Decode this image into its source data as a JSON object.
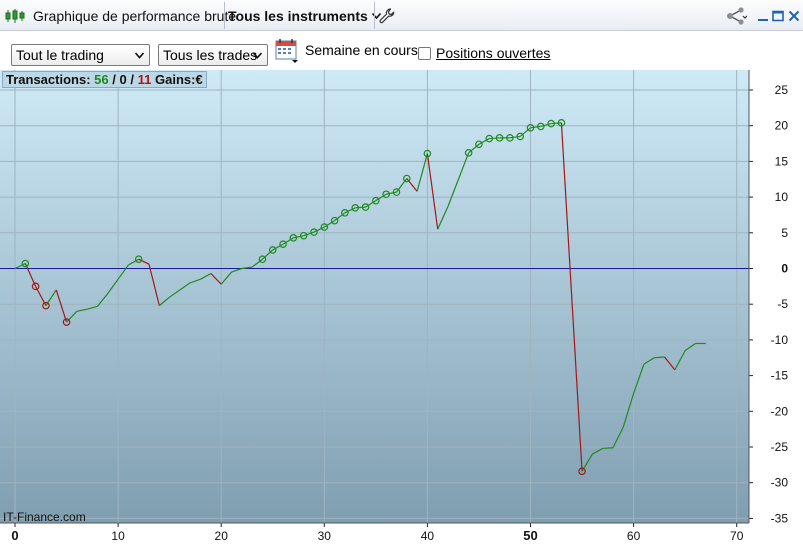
{
  "titlebar": {
    "title": "Graphique de performance brute",
    "instrument_scope": "Tous les instruments"
  },
  "icons": {
    "app": "candlestick-chart-icon",
    "wrench": "wrench-icon",
    "share": "share-icon",
    "minimize": "minimize-icon",
    "maximize": "maximize-icon",
    "close": "close-icon",
    "calendar": "calendar-icon"
  },
  "toolbar": {
    "trading_select": {
      "value": "Tout le trading"
    },
    "trades_select": {
      "value": "Tous les trades"
    },
    "week_label": "Semaine en cours",
    "positions_label": "Positions ouvertes",
    "positions_checked": false
  },
  "stats": {
    "transactions_label": "Transactions:",
    "wins": "56",
    "separator": "/",
    "neutral": "0",
    "losses": "11",
    "gains_label": "Gains:",
    "currency": "€"
  },
  "watermark": "IT-Finance.com",
  "colors": {
    "up": "#1f8a1f",
    "down": "#a01818",
    "zero_line": "#1a1a9a",
    "grid": "#9fb4c0"
  },
  "chart_data": {
    "type": "line",
    "xlim": [
      0,
      70
    ],
    "ylim": [
      -35,
      27
    ],
    "x_ticks": [
      "0",
      "10",
      "20",
      "30",
      "40",
      "50",
      "60",
      "70"
    ],
    "x_ticks_bold": [
      "0",
      "50"
    ],
    "y_ticks": [
      "25",
      "20",
      "15",
      "10",
      "5",
      "0",
      "-5",
      "-10",
      "-15",
      "-20",
      "-25",
      "-30",
      "-35"
    ],
    "grid": true,
    "zero_line": 0,
    "series": [
      {
        "values": [
          [
            0,
            0
          ],
          [
            1,
            0.7
          ],
          [
            2,
            -2.5
          ],
          [
            3,
            -5.2
          ],
          [
            4,
            -3
          ],
          [
            5,
            -7.5
          ],
          [
            6,
            -6
          ],
          [
            7,
            -5.7
          ],
          [
            8,
            -5.3
          ],
          [
            9,
            -3.5
          ],
          [
            10,
            -1.5
          ],
          [
            11,
            0.5
          ],
          [
            12,
            1.3
          ],
          [
            13,
            0.6
          ],
          [
            14,
            -5.2
          ],
          [
            15,
            -4
          ],
          [
            16,
            -3
          ],
          [
            17,
            -2
          ],
          [
            18,
            -1.5
          ],
          [
            19,
            -0.7
          ],
          [
            20,
            -2.2
          ],
          [
            21,
            -0.5
          ],
          [
            22,
            0
          ],
          [
            23,
            0.2
          ],
          [
            24,
            1.3
          ],
          [
            25,
            2.6
          ],
          [
            26,
            3.4
          ],
          [
            27,
            4.3
          ],
          [
            28,
            4.6
          ],
          [
            29,
            5.1
          ],
          [
            30,
            5.8
          ],
          [
            31,
            6.7
          ],
          [
            32,
            7.8
          ],
          [
            33,
            8.5
          ],
          [
            34,
            8.6
          ],
          [
            35,
            9.5
          ],
          [
            36,
            10.4
          ],
          [
            37,
            10.7
          ],
          [
            38,
            12.6
          ],
          [
            39,
            10.8
          ],
          [
            40,
            16.1
          ],
          [
            41,
            5.5
          ],
          [
            42,
            8.7
          ],
          [
            44,
            16.2
          ],
          [
            45,
            17.4
          ],
          [
            46,
            18.2
          ],
          [
            47,
            18.3
          ],
          [
            48,
            18.3
          ],
          [
            49,
            18.5
          ],
          [
            50,
            19.7
          ],
          [
            51,
            19.9
          ],
          [
            52,
            20.3
          ],
          [
            53,
            20.4
          ],
          [
            55,
            -28.4
          ],
          [
            56,
            -26
          ],
          [
            57,
            -25.2
          ],
          [
            58,
            -25.1
          ],
          [
            59,
            -22.2
          ],
          [
            60,
            -17.5
          ],
          [
            61,
            -13.4
          ],
          [
            62,
            -12.5
          ],
          [
            63,
            -12.4
          ],
          [
            64,
            -14.2
          ],
          [
            65,
            -11.5
          ],
          [
            66,
            -10.5
          ],
          [
            67,
            -10.5
          ]
        ],
        "markers_at_x": [
          1,
          2,
          3,
          5,
          12,
          24,
          25,
          26,
          27,
          28,
          29,
          30,
          31,
          32,
          33,
          34,
          35,
          36,
          37,
          38,
          40,
          44,
          45,
          46,
          47,
          48,
          49,
          50,
          51,
          52,
          53,
          55
        ]
      }
    ]
  }
}
